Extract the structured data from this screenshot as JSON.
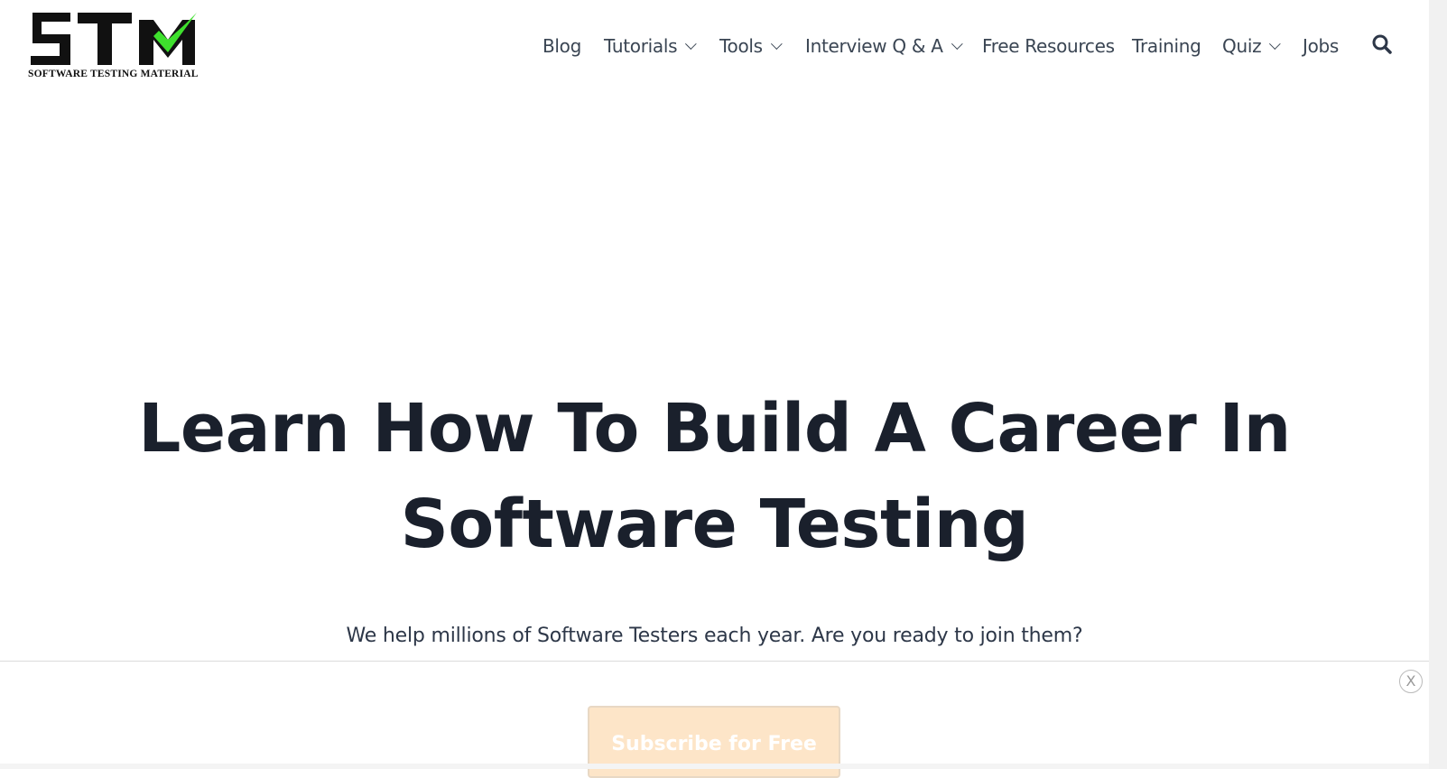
{
  "logo": {
    "letters": "STM",
    "tagline": "SOFTWARE TESTING MATERIAL",
    "check_color": "#3ee02d"
  },
  "nav": {
    "items": [
      {
        "label": "Blog",
        "dropdown": false
      },
      {
        "label": "Tutorials",
        "dropdown": true
      },
      {
        "label": "Tools",
        "dropdown": true
      },
      {
        "label": "Interview Q & A",
        "dropdown": true
      },
      {
        "label": "Free Resources",
        "dropdown": false
      },
      {
        "label": "Training",
        "dropdown": false
      },
      {
        "label": "Quiz",
        "dropdown": true
      },
      {
        "label": "Jobs",
        "dropdown": false
      }
    ],
    "search_icon": "search-icon"
  },
  "hero": {
    "title_line1": "Learn How To Build A Career In",
    "title_line2": "Software Testing",
    "subtitle": "We help millions of Software Testers each year. Are you ready to join them?"
  },
  "subscribe_bar": {
    "close_label": "X",
    "button_label": "Subscribe for Free",
    "button_color": "#fde5c8"
  }
}
